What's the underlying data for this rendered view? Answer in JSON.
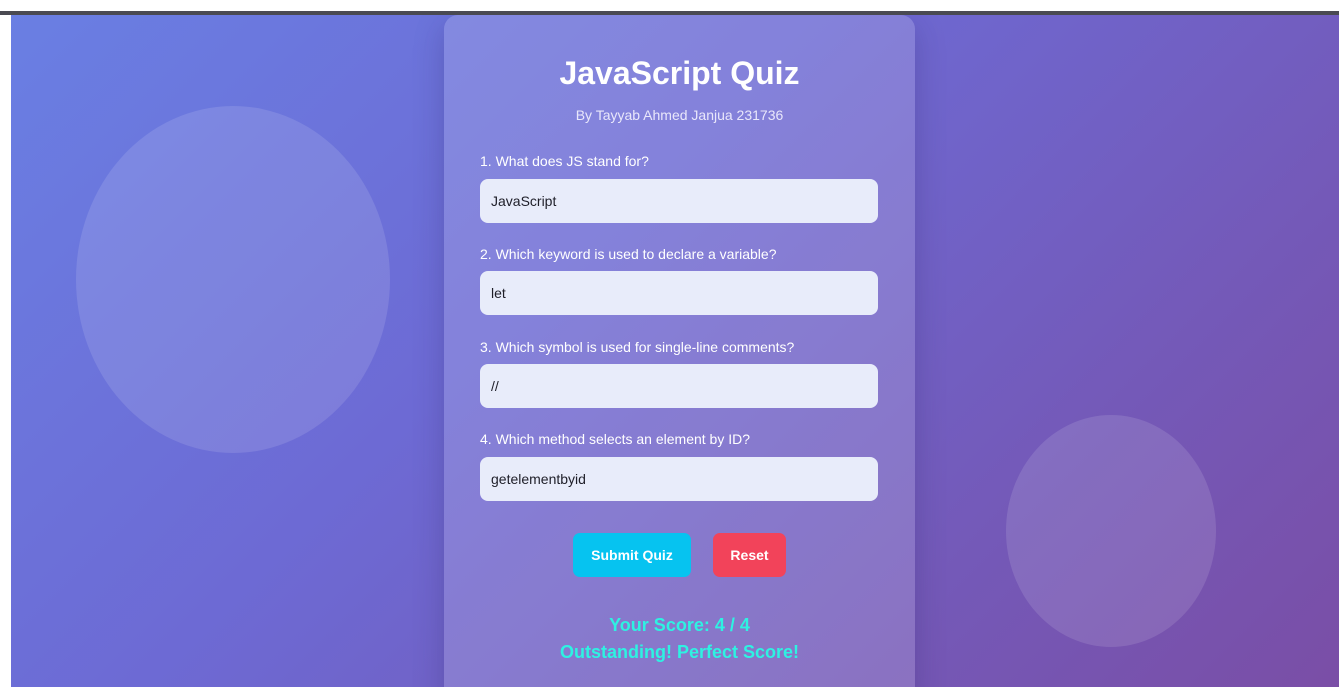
{
  "quiz": {
    "title": "JavaScript Quiz",
    "subtitle": "By Tayyab Ahmed Janjua 231736",
    "questions": [
      {
        "label": "1. What does JS stand for?",
        "value": "JavaScript"
      },
      {
        "label": "2. Which keyword is used to declare a variable?",
        "value": "let"
      },
      {
        "label": "3. Which symbol is used for single-line comments?",
        "value": "//"
      },
      {
        "label": "4. Which method selects an element by ID?",
        "value": "getelementbyid"
      }
    ],
    "submit_label": "Submit Quiz",
    "reset_label": "Reset",
    "score_text": "Your Score: 4 / 4",
    "score_message": "Outstanding! Perfect Score!"
  },
  "colors": {
    "submit_button": "#06c3f0",
    "reset_button": "#f2435a",
    "score_text": "#2ef2e2",
    "background_start": "#6a7fe3",
    "background_end": "#7a4ea6"
  }
}
